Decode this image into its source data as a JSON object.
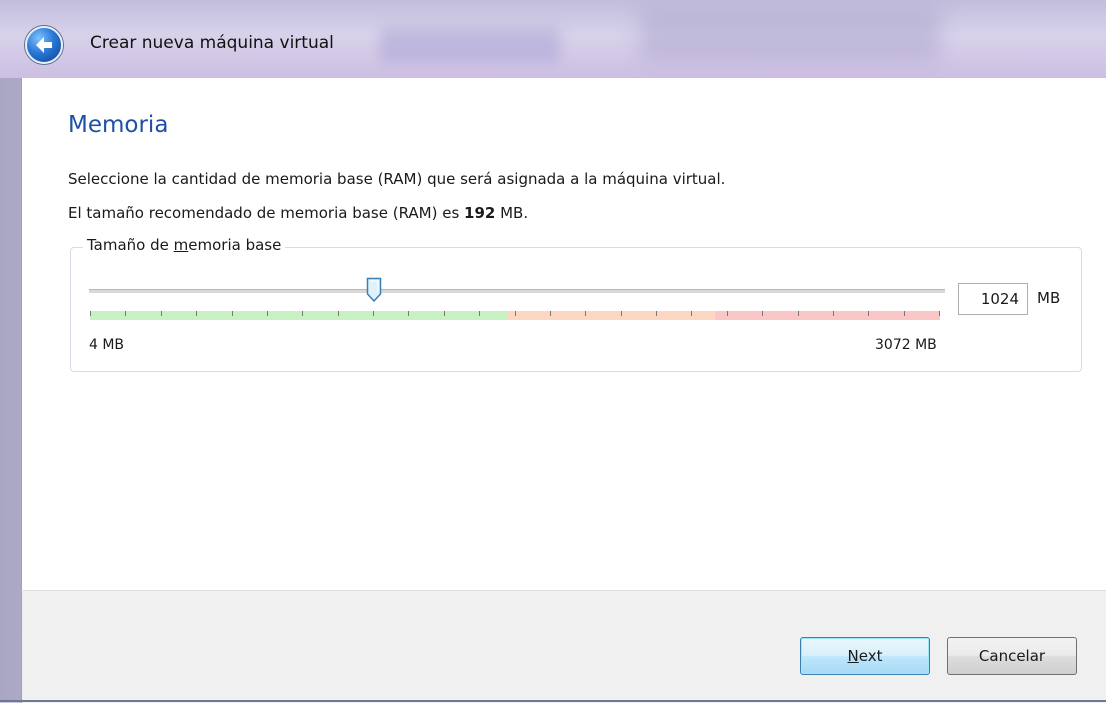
{
  "window": {
    "title": "Crear nueva máquina virtual",
    "back_icon": "back-arrow-icon"
  },
  "page": {
    "heading": "Memoria",
    "description": "Seleccione la cantidad de memoria base (RAM) que será asignada a la máquina virtual.",
    "recommend_prefix": "El tamaño recomendado de memoria base (RAM) es ",
    "recommend_value": "192",
    "recommend_suffix": " MB."
  },
  "memory": {
    "group_label_pre": "Tamaño de ",
    "group_label_mnemonic": "m",
    "group_label_post": "emoria base",
    "slider_value_fraction": 0.333,
    "min_label": "4 MB",
    "max_label": "3072 MB",
    "value": "1024",
    "unit": "MB",
    "zone_colors": {
      "ok": "#c9f2c4",
      "warn": "#fcd7c2",
      "danger": "#fbc6c6"
    }
  },
  "buttons": {
    "next_mnemonic": "N",
    "next_rest": "ext",
    "cancel": "Cancelar"
  }
}
